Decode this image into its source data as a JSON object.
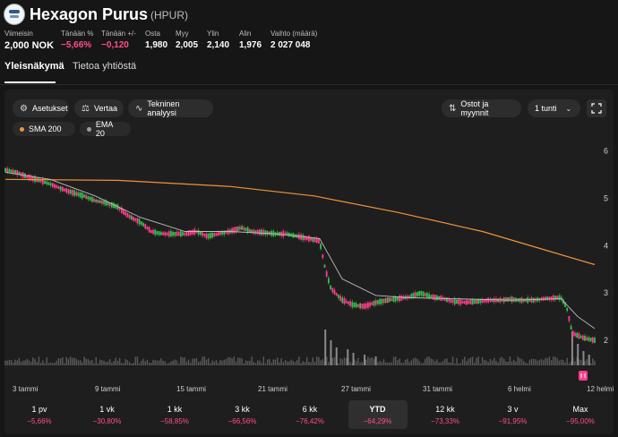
{
  "company": {
    "name": "Hexagon Purus",
    "ticker": "(HPUR)"
  },
  "stats": [
    {
      "label": "Viimeisin",
      "value": "2,000 NOK",
      "neg": false
    },
    {
      "label": "Tänään %",
      "value": "−5,66%",
      "neg": true
    },
    {
      "label": "Tänään +/-",
      "value": "−0,120",
      "neg": true
    },
    {
      "label": "Osta",
      "value": "1,980",
      "neg": false
    },
    {
      "label": "Myy",
      "value": "2,005",
      "neg": false
    },
    {
      "label": "Ylin",
      "value": "2,140",
      "neg": false
    },
    {
      "label": "Alin",
      "value": "1,976",
      "neg": false
    },
    {
      "label": "Vaihto (määrä)",
      "value": "2 027 048",
      "neg": false
    }
  ],
  "tabs": [
    "Yleisnäkymä",
    "Tietoa yhtiöstä"
  ],
  "toolbar": {
    "settings": "Asetukset",
    "compare": "Vertaa",
    "technical": "Tekninen analyysi",
    "trades": "Ostot ja myynnit",
    "interval": "1 tunti"
  },
  "indicators": [
    {
      "name": "SMA 200",
      "color": "#f0923a"
    },
    {
      "name": "EMA 20",
      "color": "#9e9e9e"
    }
  ],
  "colors": {
    "up": "#35c04a",
    "down": "#ff3d8b",
    "negative_text": "#ff4d8d"
  },
  "event_marker": "dividend/event marker",
  "chart_data": {
    "type": "candlestick",
    "interval": "1 tunti",
    "y_ticks": [
      6,
      5,
      4,
      3,
      2
    ],
    "ylim": [
      1.7,
      6.2
    ],
    "x_ticks": [
      "3 tammi",
      "9 tammi",
      "15 tammi",
      "21 tammi",
      "27 tammi",
      "31 tammi",
      "6 helmi",
      "12 helmi"
    ],
    "price_path": [
      [
        0,
        5.6
      ],
      [
        2,
        5.55
      ],
      [
        4,
        5.45
      ],
      [
        6,
        5.38
      ],
      [
        8,
        5.3
      ],
      [
        10,
        5.2
      ],
      [
        12,
        5.12
      ],
      [
        14,
        5.05
      ],
      [
        16,
        4.95
      ],
      [
        18,
        4.9
      ],
      [
        20,
        4.82
      ],
      [
        22,
        4.62
      ],
      [
        24,
        4.5
      ],
      [
        26,
        4.3
      ],
      [
        28,
        4.25
      ],
      [
        30,
        4.25
      ],
      [
        32,
        4.25
      ],
      [
        34,
        4.3
      ],
      [
        36,
        4.2
      ],
      [
        38,
        4.25
      ],
      [
        40,
        4.3
      ],
      [
        42,
        4.38
      ],
      [
        44,
        4.3
      ],
      [
        46,
        4.28
      ],
      [
        48,
        4.25
      ],
      [
        50,
        4.25
      ],
      [
        52,
        4.2
      ],
      [
        54,
        4.15
      ],
      [
        56,
        4.1
      ],
      [
        57,
        3.5
      ],
      [
        58,
        3.1
      ],
      [
        60,
        2.85
      ],
      [
        62,
        2.75
      ],
      [
        64,
        2.72
      ],
      [
        66,
        2.8
      ],
      [
        68,
        2.85
      ],
      [
        70,
        2.88
      ],
      [
        72,
        2.92
      ],
      [
        74,
        3.0
      ],
      [
        76,
        2.92
      ],
      [
        78,
        2.88
      ],
      [
        80,
        2.82
      ],
      [
        82,
        2.8
      ],
      [
        84,
        2.82
      ],
      [
        86,
        2.85
      ],
      [
        88,
        2.85
      ],
      [
        90,
        2.87
      ],
      [
        92,
        2.85
      ],
      [
        94,
        2.85
      ],
      [
        96,
        2.88
      ],
      [
        98,
        2.9
      ],
      [
        99,
        2.9
      ],
      [
        100,
        2.7
      ],
      [
        101,
        2.15
      ],
      [
        103,
        2.05
      ],
      [
        105,
        2.0
      ]
    ],
    "sma200": [
      [
        0,
        5.4
      ],
      [
        20,
        5.38
      ],
      [
        40,
        5.25
      ],
      [
        55,
        5.05
      ],
      [
        70,
        4.7
      ],
      [
        85,
        4.3
      ],
      [
        95,
        3.95
      ],
      [
        105,
        3.6
      ]
    ],
    "ema20": [
      [
        0,
        5.55
      ],
      [
        8,
        5.4
      ],
      [
        16,
        5.05
      ],
      [
        24,
        4.6
      ],
      [
        32,
        4.3
      ],
      [
        40,
        4.3
      ],
      [
        48,
        4.25
      ],
      [
        56,
        4.15
      ],
      [
        60,
        3.3
      ],
      [
        66,
        2.95
      ],
      [
        72,
        2.9
      ],
      [
        80,
        2.88
      ],
      [
        90,
        2.85
      ],
      [
        99,
        2.88
      ],
      [
        102,
        2.5
      ],
      [
        105,
        2.25
      ]
    ],
    "volume_spikes": [
      [
        57,
        1.0
      ],
      [
        58,
        0.7
      ],
      [
        59,
        0.5
      ],
      [
        61,
        0.45
      ],
      [
        62,
        0.35
      ],
      [
        64,
        0.3
      ],
      [
        66,
        0.25
      ],
      [
        101,
        0.95
      ],
      [
        102,
        0.6
      ],
      [
        103,
        0.4
      ],
      [
        104,
        0.3
      ]
    ]
  },
  "ranges": [
    {
      "label": "1 pv",
      "change": "−5,66%"
    },
    {
      "label": "1 vk",
      "change": "−30,80%"
    },
    {
      "label": "1 kk",
      "change": "−58,85%"
    },
    {
      "label": "3 kk",
      "change": "−66,56%"
    },
    {
      "label": "6 kk",
      "change": "−76,42%"
    },
    {
      "label": "YTD",
      "change": "−64,29%",
      "active": true
    },
    {
      "label": "12 kk",
      "change": "−73,33%"
    },
    {
      "label": "3 v",
      "change": "−91,95%"
    },
    {
      "label": "Max",
      "change": "−95,00%"
    }
  ]
}
